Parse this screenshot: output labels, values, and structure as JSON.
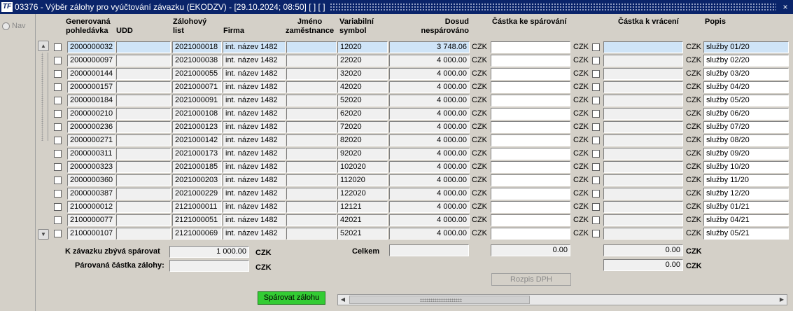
{
  "window": {
    "title": "03376 - Výběr zálohy pro vyúčtování závazku (EKODZV) - [29.10.2024; 08:50]  [ ]  [ ]",
    "icon": "TF",
    "close": "×"
  },
  "nav": {
    "label": "Nav"
  },
  "headers": {
    "gen_line1": "Generovaná",
    "gen_line2": "pohledávka",
    "udd": "UDD",
    "zal_line1": "Zálohový",
    "zal_line2": "list",
    "firma": "Firma",
    "jmeno_line1": "Jméno",
    "jmeno_line2": "zaměstnance",
    "var_line1": "Variabilní",
    "var_line2": "symbol",
    "dosud_line1": "Dosud",
    "dosud_line2": "nespárováno",
    "castka_spar": "Částka ke spárování",
    "castka_vrac": "Částka k vrácení",
    "popis": "Popis"
  },
  "rows": [
    {
      "gen": "2000000032",
      "udd": "",
      "zal": "2021000018",
      "firma": "int. název 1482",
      "jmeno": "",
      "vs": "12020",
      "dosud": "3 748.06",
      "cur1": "CZK",
      "spar": "",
      "cur2": "CZK",
      "vrac": "",
      "cur3": "CZK",
      "popis": "služby 01/20"
    },
    {
      "gen": "2000000097",
      "udd": "",
      "zal": "2021000038",
      "firma": "int. název 1482",
      "jmeno": "",
      "vs": "22020",
      "dosud": "4 000.00",
      "cur1": "CZK",
      "spar": "",
      "cur2": "CZK",
      "vrac": "",
      "cur3": "CZK",
      "popis": "služby 02/20"
    },
    {
      "gen": "2000000144",
      "udd": "",
      "zal": "2021000055",
      "firma": "int. název 1482",
      "jmeno": "",
      "vs": "32020",
      "dosud": "4 000.00",
      "cur1": "CZK",
      "spar": "",
      "cur2": "CZK",
      "vrac": "",
      "cur3": "CZK",
      "popis": "služby 03/20"
    },
    {
      "gen": "2000000157",
      "udd": "",
      "zal": "2021000071",
      "firma": "int. název 1482",
      "jmeno": "",
      "vs": "42020",
      "dosud": "4 000.00",
      "cur1": "CZK",
      "spar": "",
      "cur2": "CZK",
      "vrac": "",
      "cur3": "CZK",
      "popis": "služby 04/20"
    },
    {
      "gen": "2000000184",
      "udd": "",
      "zal": "2021000091",
      "firma": "int. název 1482",
      "jmeno": "",
      "vs": "52020",
      "dosud": "4 000.00",
      "cur1": "CZK",
      "spar": "",
      "cur2": "CZK",
      "vrac": "",
      "cur3": "CZK",
      "popis": "služby 05/20"
    },
    {
      "gen": "2000000210",
      "udd": "",
      "zal": "2021000108",
      "firma": "int. název 1482",
      "jmeno": "",
      "vs": "62020",
      "dosud": "4 000.00",
      "cur1": "CZK",
      "spar": "",
      "cur2": "CZK",
      "vrac": "",
      "cur3": "CZK",
      "popis": "služby 06/20"
    },
    {
      "gen": "2000000236",
      "udd": "",
      "zal": "2021000123",
      "firma": "int. název 1482",
      "jmeno": "",
      "vs": "72020",
      "dosud": "4 000.00",
      "cur1": "CZK",
      "spar": "",
      "cur2": "CZK",
      "vrac": "",
      "cur3": "CZK",
      "popis": "služby 07/20"
    },
    {
      "gen": "2000000271",
      "udd": "",
      "zal": "2021000142",
      "firma": "int. název 1482",
      "jmeno": "",
      "vs": "82020",
      "dosud": "4 000.00",
      "cur1": "CZK",
      "spar": "",
      "cur2": "CZK",
      "vrac": "",
      "cur3": "CZK",
      "popis": "služby 08/20"
    },
    {
      "gen": "2000000311",
      "udd": "",
      "zal": "2021000173",
      "firma": "int. název 1482",
      "jmeno": "",
      "vs": "92020",
      "dosud": "4 000.00",
      "cur1": "CZK",
      "spar": "",
      "cur2": "CZK",
      "vrac": "",
      "cur3": "CZK",
      "popis": "služby 09/20"
    },
    {
      "gen": "2000000323",
      "udd": "",
      "zal": "2021000185",
      "firma": "int. název 1482",
      "jmeno": "",
      "vs": "102020",
      "dosud": "4 000.00",
      "cur1": "CZK",
      "spar": "",
      "cur2": "CZK",
      "vrac": "",
      "cur3": "CZK",
      "popis": "služby 10/20"
    },
    {
      "gen": "2000000360",
      "udd": "",
      "zal": "2021000203",
      "firma": "int. název 1482",
      "jmeno": "",
      "vs": "112020",
      "dosud": "4 000.00",
      "cur1": "CZK",
      "spar": "",
      "cur2": "CZK",
      "vrac": "",
      "cur3": "CZK",
      "popis": "služby 11/20"
    },
    {
      "gen": "2000000387",
      "udd": "",
      "zal": "2021000229",
      "firma": "int. název 1482",
      "jmeno": "",
      "vs": "122020",
      "dosud": "4 000.00",
      "cur1": "CZK",
      "spar": "",
      "cur2": "CZK",
      "vrac": "",
      "cur3": "CZK",
      "popis": "služby 12/20"
    },
    {
      "gen": "2100000012",
      "udd": "",
      "zal": "2121000011",
      "firma": "int. název 1482",
      "jmeno": "",
      "vs": "12121",
      "dosud": "4 000.00",
      "cur1": "CZK",
      "spar": "",
      "cur2": "CZK",
      "vrac": "",
      "cur3": "CZK",
      "popis": "služby 01/21"
    },
    {
      "gen": "2100000077",
      "udd": "",
      "zal": "2121000051",
      "firma": "int. název 1482",
      "jmeno": "",
      "vs": "42021",
      "dosud": "4 000.00",
      "cur1": "CZK",
      "spar": "",
      "cur2": "CZK",
      "vrac": "",
      "cur3": "CZK",
      "popis": "služby 04/21"
    },
    {
      "gen": "2100000107",
      "udd": "",
      "zal": "2121000069",
      "firma": "int. název 1482",
      "jmeno": "",
      "vs": "52021",
      "dosud": "4 000.00",
      "cur1": "CZK",
      "spar": "",
      "cur2": "CZK",
      "vrac": "",
      "cur3": "CZK",
      "popis": "služby 05/21"
    }
  ],
  "footer": {
    "zbyva_label": "K závazku zbývá spárovat",
    "zbyva_value": "1 000.00",
    "zbyva_cur": "CZK",
    "parovana_label": "Párovaná částka zálohy:",
    "parovana_value": "",
    "parovana_cur": "CZK",
    "celkem_label": "Celkem",
    "celkem_dosud": "",
    "celkem_spar": "0.00",
    "celkem_vrac": "0.00",
    "celkem_vrac_cur": "CZK",
    "vrac2_value": "0.00",
    "vrac2_cur": "CZK"
  },
  "buttons": {
    "rozpis": "Rozpis DPH",
    "sparovat": "Spárovat zálohu"
  },
  "colors": {
    "title_bg": "#0a246a",
    "highlight_row": "#cfe4f7",
    "green_button": "#33cc33"
  }
}
